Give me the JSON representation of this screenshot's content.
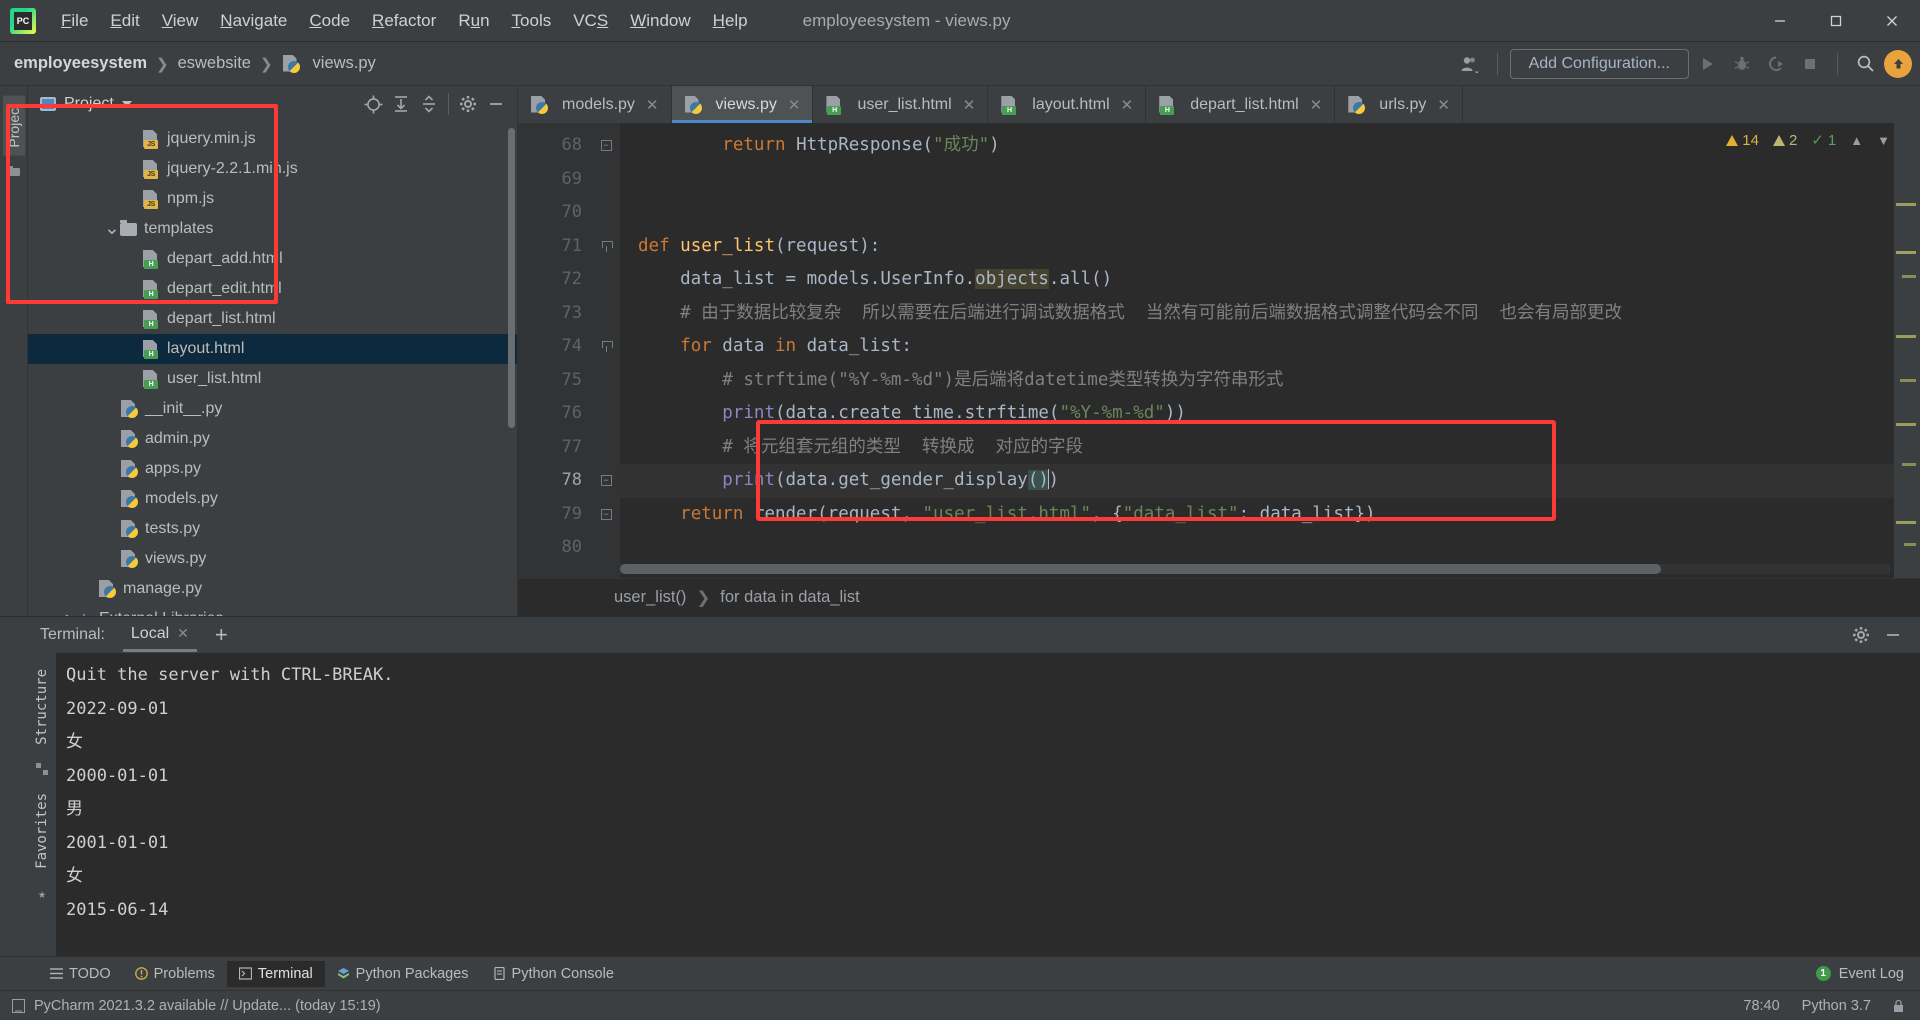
{
  "window": {
    "title": "employeesystem - views.py",
    "minimize_label": "—",
    "maximize_label": "❐",
    "close_label": "✕"
  },
  "menubar": {
    "items": [
      {
        "label": "File",
        "mnemonic": "F"
      },
      {
        "label": "Edit",
        "mnemonic": "E"
      },
      {
        "label": "View",
        "mnemonic": "V"
      },
      {
        "label": "Navigate",
        "mnemonic": "N"
      },
      {
        "label": "Code",
        "mnemonic": "C"
      },
      {
        "label": "Refactor",
        "mnemonic": "R"
      },
      {
        "label": "Run",
        "mnemonic": "u"
      },
      {
        "label": "Tools",
        "mnemonic": "T"
      },
      {
        "label": "VCS",
        "mnemonic": "S"
      },
      {
        "label": "Window",
        "mnemonic": "W"
      },
      {
        "label": "Help",
        "mnemonic": "H"
      }
    ]
  },
  "navbar": {
    "breadcrumb": [
      "employeesystem",
      "eswebsite",
      "views.py"
    ],
    "add_configuration": "Add Configuration...",
    "icons": {
      "user": "user-icon",
      "run": "run-icon",
      "debug": "debug-icon",
      "run_coverage": "run-coverage-icon",
      "stop": "stop-icon",
      "search": "search-icon",
      "update": "update-icon"
    }
  },
  "left_rail": {
    "project_tab": "Project",
    "structure_tab": "Structure",
    "favorites_tab": "Favorites"
  },
  "project_panel": {
    "title": "Project",
    "tree": [
      {
        "label": "jquery.min.js",
        "indent": 4,
        "icon": "js",
        "twisty": "",
        "selected": false
      },
      {
        "label": "jquery-2.2.1.min.js",
        "indent": 4,
        "icon": "js",
        "twisty": "",
        "selected": false
      },
      {
        "label": "npm.js",
        "indent": 4,
        "icon": "js",
        "twisty": "",
        "selected": false
      },
      {
        "label": "templates",
        "indent": 3,
        "icon": "folder",
        "twisty": "v",
        "selected": false
      },
      {
        "label": "depart_add.html",
        "indent": 4,
        "icon": "html",
        "twisty": "",
        "selected": false
      },
      {
        "label": "depart_edit.html",
        "indent": 4,
        "icon": "html",
        "twisty": "",
        "selected": false
      },
      {
        "label": "depart_list.html",
        "indent": 4,
        "icon": "html",
        "twisty": "",
        "selected": false
      },
      {
        "label": "layout.html",
        "indent": 4,
        "icon": "html",
        "twisty": "",
        "selected": true
      },
      {
        "label": "user_list.html",
        "indent": 4,
        "icon": "html",
        "twisty": "",
        "selected": false
      },
      {
        "label": "__init__.py",
        "indent": 3,
        "icon": "py",
        "twisty": "",
        "selected": false
      },
      {
        "label": "admin.py",
        "indent": 3,
        "icon": "py",
        "twisty": "",
        "selected": false
      },
      {
        "label": "apps.py",
        "indent": 3,
        "icon": "py",
        "twisty": "",
        "selected": false
      },
      {
        "label": "models.py",
        "indent": 3,
        "icon": "py",
        "twisty": "",
        "selected": false
      },
      {
        "label": "tests.py",
        "indent": 3,
        "icon": "py",
        "twisty": "",
        "selected": false
      },
      {
        "label": "views.py",
        "indent": 3,
        "icon": "py",
        "twisty": "",
        "selected": false
      },
      {
        "label": "manage.py",
        "indent": 2,
        "icon": "py",
        "twisty": "",
        "selected": false
      },
      {
        "label": "External Libraries",
        "indent": 1,
        "icon": "lib",
        "twisty": ">",
        "selected": false
      }
    ]
  },
  "editor": {
    "tabs": [
      {
        "label": "models.py",
        "icon": "py",
        "active": false
      },
      {
        "label": "views.py",
        "icon": "py",
        "active": true
      },
      {
        "label": "user_list.html",
        "icon": "html",
        "active": false
      },
      {
        "label": "layout.html",
        "icon": "html",
        "active": false
      },
      {
        "label": "depart_list.html",
        "icon": "html",
        "active": false
      },
      {
        "label": "urls.py",
        "icon": "py",
        "active": false
      }
    ],
    "line_numbers": [
      68,
      69,
      70,
      71,
      72,
      73,
      74,
      75,
      76,
      77,
      78,
      79,
      80
    ],
    "lines": [
      "        return HttpResponse(\"成功\")",
      "",
      "",
      "def user_list(request):",
      "    data_list = models.UserInfo.objects.all()",
      "    # 由于数据比较复杂  所以需要在后端进行调试数据格式  当然有可能前后端数据格式调整代码会不同  也会有局部更改",
      "    for data in data_list:",
      "        # strftime(\"%Y-%m-%d\")是后端将datetime类型转换为字符串形式",
      "        print(data.create_time.strftime(\"%Y-%m-%d\"))",
      "        # 将元组套元组的类型  转换成  对应的字段",
      "        print(data.get_gender_display())",
      "    return render(request, \"user_list.html\", {\"data_list\": data_list})",
      ""
    ],
    "inspections": {
      "warnings": "14",
      "weak_warnings": "2",
      "checks": "1"
    },
    "breadcrumbs": [
      "user_list()",
      "for data in data_list"
    ]
  },
  "terminal": {
    "label": "Terminal:",
    "tab": "Local",
    "add_label": "+",
    "output": [
      "Quit the server with CTRL-BREAK.",
      "2022-09-01",
      "女",
      "2000-01-01",
      "男",
      "2001-01-01",
      "女",
      "2015-06-14"
    ]
  },
  "toolwindow_bar": {
    "items": [
      {
        "label": "TODO",
        "icon": "todo-icon",
        "active": false
      },
      {
        "label": "Problems",
        "icon": "problems-icon",
        "active": false
      },
      {
        "label": "Terminal",
        "icon": "terminal-icon",
        "active": true
      },
      {
        "label": "Python Packages",
        "icon": "python-packages-icon",
        "active": false
      },
      {
        "label": "Python Console",
        "icon": "python-console-icon",
        "active": false
      }
    ],
    "event_log": "Event Log",
    "event_count": "1"
  },
  "statusbar": {
    "message": "PyCharm 2021.3.2 available // Update... (today 15:19)",
    "caret_position": "78:40",
    "interpreter": "Python 3.7"
  },
  "colors": {
    "accent": "#4a88c7",
    "highlight_box": "#fd3a36",
    "selection": "#0d293e",
    "warning": "#e0b030",
    "update_badge": "#e8a33d"
  }
}
